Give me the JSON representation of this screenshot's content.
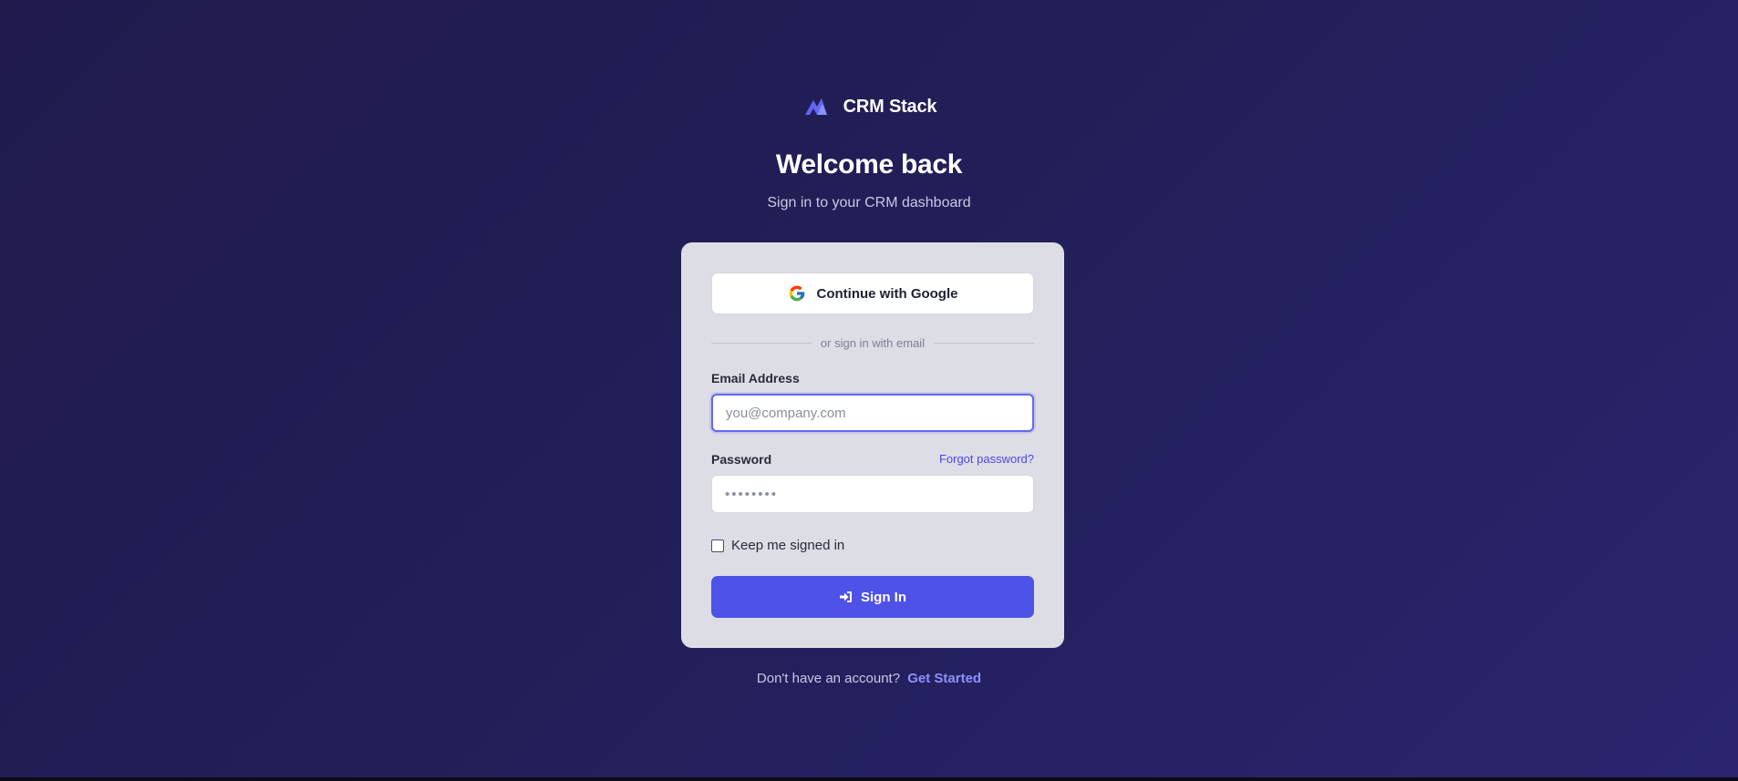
{
  "brand": {
    "name": "CRM Stack",
    "logo_icon": "crm-stack-logo-icon"
  },
  "header": {
    "title": "Welcome back",
    "subtitle": "Sign in to your CRM dashboard"
  },
  "google_button": {
    "label": "Continue with Google",
    "icon": "google-icon"
  },
  "divider": {
    "text": "or sign in with email"
  },
  "email": {
    "label": "Email Address",
    "placeholder": "you@company.com",
    "value": ""
  },
  "password": {
    "label": "Password",
    "forgot_label": "Forgot password?",
    "placeholder": "••••••••",
    "value": ""
  },
  "remember": {
    "label": "Keep me signed in",
    "checked": false
  },
  "sign_in": {
    "label": "Sign In",
    "icon": "sign-in-icon"
  },
  "footer": {
    "prompt": "Don't have an account?",
    "link": "Get Started"
  },
  "colors": {
    "accent": "#4f52e6",
    "background_start": "#1f1b4d",
    "background_end": "#2b2570",
    "card": "#dddde6",
    "link": "#8b91ff"
  }
}
